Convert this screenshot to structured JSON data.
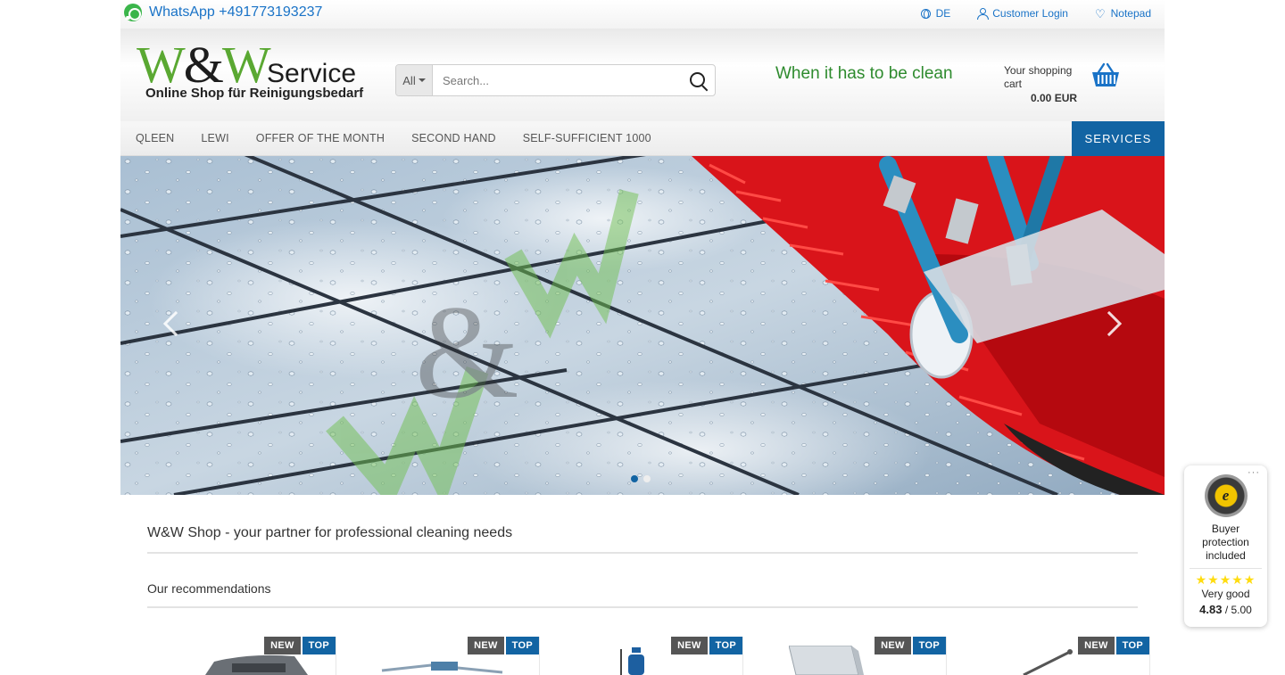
{
  "topbar": {
    "whatsapp": "WhatsApp +491773193237",
    "language": "DE",
    "login": "Customer Login",
    "notepad": "Notepad"
  },
  "header": {
    "logo_w1": "W",
    "logo_amp": "&",
    "logo_w2": "W",
    "logo_service": "Service",
    "logo_sub": "Online Shop für Reinigungsbedarf",
    "search_category": "All",
    "search_placeholder": "Search...",
    "slogan": "When it has to be clean",
    "cart_label": "Your shopping cart",
    "cart_total": "0.00 EUR"
  },
  "nav": {
    "items": [
      "QLEEN",
      "LEWI",
      "OFFER OF THE MONTH",
      "SECOND HAND",
      "SELF-SUFFICIENT 1000"
    ],
    "services": "SERVICES"
  },
  "slider": {
    "active_slide": 1,
    "total_slides": 2
  },
  "content": {
    "headline": "W&W Shop - your partner for professional cleaning needs",
    "recommendations": "Our recommendations"
  },
  "products": [
    {
      "badge_new": "NEW",
      "badge_top": "TOP"
    },
    {
      "badge_new": "NEW",
      "badge_top": "TOP"
    },
    {
      "badge_new": "NEW",
      "badge_top": "TOP"
    },
    {
      "badge_new": "NEW",
      "badge_top": "TOP"
    },
    {
      "badge_new": "NEW",
      "badge_top": "TOP"
    }
  ],
  "trusted_shops": {
    "seal": "e",
    "protection": "Buyer protection included",
    "stars": "★★★★★",
    "rating_text": "Very good",
    "score": "4.83",
    "score_max": "/ 5.00"
  },
  "colors": {
    "accent": "#1264a3",
    "logo_green": "#5aa832",
    "slogan_green": "#2e8b2e",
    "link": "#1a73c7"
  }
}
